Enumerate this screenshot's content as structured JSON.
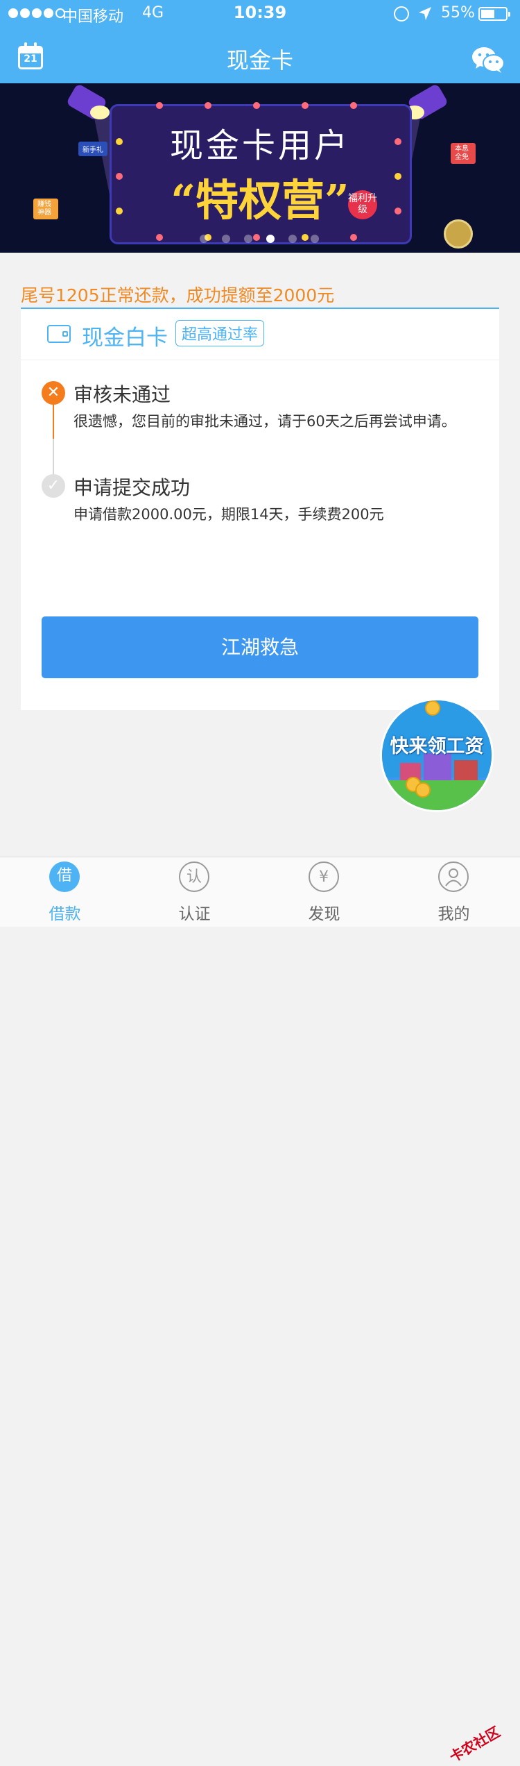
{
  "status_bar": {
    "carrier": "中国移动",
    "network": "4G",
    "time": "10:39",
    "battery": "55%",
    "battery_level": 0.55
  },
  "nav": {
    "title": "现金卡",
    "calendar_day": "21",
    "left_icon": "calendar-icon",
    "right_icon": "wechat-icon"
  },
  "banner": {
    "title": "现金卡用户",
    "subtitle": "“特权营”",
    "badge": "福利升级",
    "tag_left_top": "新手礼",
    "tag_left_bottom": "赚钱神器",
    "tag_right": "本息全免",
    "slide_count": 6,
    "active_slide": 4
  },
  "notice": "尾号1205正常还款，成功提额至2000元",
  "card": {
    "title": "现金白卡",
    "badge": "超高通过率",
    "steps": [
      {
        "status": "failed",
        "title": "审核未通过",
        "desc": "很遗憾，您目前的审批未通过，请于60天之后再尝试申请。"
      },
      {
        "status": "done",
        "title": "申请提交成功",
        "desc": "申请借款2000.00元，期限14天，手续费200元"
      }
    ],
    "button": "江湖救急"
  },
  "promo": {
    "text": "快来领工资"
  },
  "tabs": [
    {
      "label": "借款",
      "icon_text": "借",
      "active": true
    },
    {
      "label": "认证",
      "icon_text": "认",
      "active": false
    },
    {
      "label": "发现",
      "icon_text": "¥",
      "active": false
    },
    {
      "label": "我的",
      "icon_text": "",
      "active": false
    }
  ],
  "watermark": "卡农社区",
  "colors": {
    "primary": "#4db3f4",
    "button": "#3d97f1",
    "warning": "#f08a24",
    "fail": "#f57c1c",
    "done": "#cfcfcf"
  }
}
